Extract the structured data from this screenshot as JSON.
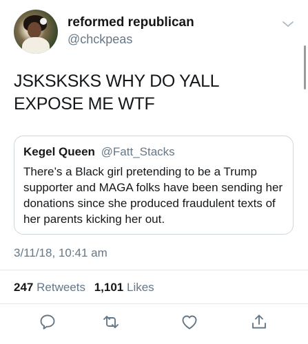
{
  "author": {
    "name": "reformed republican",
    "handle": "@chckpeas"
  },
  "tweet": {
    "text": "JSKSKSKS WHY DO YALL EXPOSE ME WTF",
    "timestamp": "3/11/18, 10:41 am"
  },
  "quoted_tweet": {
    "name": "Kegel Queen",
    "handle": "@Fatt_Stacks",
    "text": "There’s a Black girl pretending to be a Trump supporter and MAGA folks have been sending her donations since she produced fraudulent texts of her parents kicking her out."
  },
  "stats": {
    "retweets_count": "247",
    "retweets_label": "Retweets",
    "likes_count": "1,101",
    "likes_label": "Likes"
  },
  "actions": {
    "reply_icon": "reply-icon",
    "retweet_icon": "retweet-icon",
    "like_icon": "heart-icon",
    "share_icon": "share-icon"
  },
  "colors": {
    "text": "#14171a",
    "secondary": "#657786",
    "border": "#ccd6dd",
    "icons": "#657786"
  }
}
